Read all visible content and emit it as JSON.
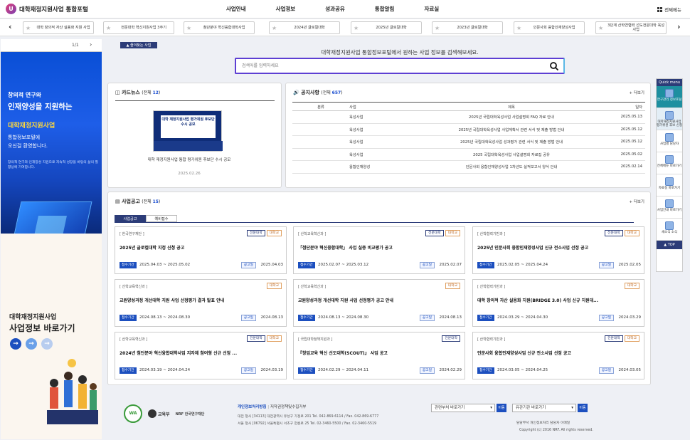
{
  "header": {
    "logo_text": "대학재정지원사업 통합포털",
    "logo_mark": "U",
    "nav": [
      "사업안내",
      "사업정보",
      "성과공유",
      "통합알림",
      "자료실"
    ],
    "all_menu": "전체메뉴"
  },
  "quickbar": {
    "items": [
      "대학 창의적 자산 실용화 지원 사업",
      "전문대학 혁신지원사업 3주기",
      "첨단분야 혁신융합대학사업",
      "2024년 글로컬대학",
      "2025년 글로컬대학",
      "2023년 글로컬대학",
      "인문사회 융합인재양성사업",
      "3단계 산학연협력 선도전문대학 육성사업"
    ]
  },
  "left_banner": {
    "page": "1/1",
    "line1": "창의적 연구와",
    "line2": "인재양성을 지원하는",
    "line3": "대학재정지원사업",
    "line4": "통합정보포털에",
    "line5": "오신걸 환영합니다.",
    "desc": "창의적 연구와 인재양성 지원으로 지속적 성장을 바탕의 삶의 질 향상에 기여합니다.",
    "bottom_line1": "대학재정지원사업",
    "bottom_line2": "사업정보 바로가기"
  },
  "toggle_label": "즐겨찾는 사업",
  "search": {
    "title": "대학재정지원사업 통합정보포털에서 원하는 사업 정보를 검색해보세요.",
    "placeholder": "검색어를 입력하세요"
  },
  "cardnews": {
    "title": "카드뉴스",
    "count_pre": "(전체 ",
    "count": "12",
    "count_post": ")",
    "image_text": "대학 재정지원사업 평가위원 후보단 수시 공모",
    "caption": "대학 재정지원사업 통합 평가위원 후보단 수시 공모",
    "date": "2025.02.26"
  },
  "notices": {
    "title": "공지사항",
    "count_pre": "(전체 ",
    "count": "657",
    "count_post": ")",
    "more": "+ 더보기",
    "headers": [
      "분류",
      "사업",
      "제목",
      "일자"
    ],
    "rows": [
      {
        "cat": "",
        "biz": "육성사업",
        "title": "2025년 국립대학육성사업 사업설명회 FAQ 자료 안내",
        "date": "2025.05.13"
      },
      {
        "cat": "",
        "biz": "육성사업",
        "title": "2025년 국립대학육성사업 사업계획서 관련 서식 및 제출 방법 안내",
        "date": "2025.05.12"
      },
      {
        "cat": "",
        "biz": "육성사업",
        "title": "2025년 국립대학육성사업 성과평가 관련 서식 및 제출 방법 안내",
        "date": "2025.05.12"
      },
      {
        "cat": "",
        "biz": "육성사업",
        "title": "2025 국립대학육성사업 사업설명회 자료집 공유",
        "date": "2025.05.02"
      },
      {
        "cat": "",
        "biz": "융합인재양성",
        "title": "인문사회 융합인재양성사업 1차년도 실적보고서 양식 안내",
        "date": "2025.02.14"
      }
    ]
  },
  "biz_announce": {
    "title": "사업공고",
    "count_pre": "(전체 ",
    "count": "15",
    "count_post": ")",
    "more": "+ 더보기",
    "tabs": [
      "사업공고",
      "예비접수"
    ],
    "period_label": "접수기간",
    "notice_label": "공고일",
    "cards": [
      {
        "org": "[ 한국연구재단 ]",
        "tags": [
          "전문대학",
          "대학교"
        ],
        "title": "2025년 글로컬대학 지정 신청 공고",
        "period": "2025.04.03 ~ 2025.05.02",
        "date": "2025.04.03"
      },
      {
        "org": "[ 산학교육혁신과 ]",
        "tags": [
          "전문대학",
          "대학교"
        ],
        "title": "「첨단분야 혁신융합대학」 사업 실증 비교평가 공고",
        "period": "2025.02.07 ~ 2025.03.12",
        "date": "2025.02.07"
      },
      {
        "org": "[ 산학협력기반과 ]",
        "tags": [
          "전문대학",
          "대학교"
        ],
        "title": "2025년 인문사회 융합인재양성사업 신규 전소사업 선정 공고",
        "period": "2025.02.05 ~ 2025.04.24",
        "date": "2025.02.05"
      },
      {
        "org": "[ 산학교육혁신과 ]",
        "tags": [
          "대학교"
        ],
        "title": "교원양성과정 개선대학 지원 사업 선정평가 결과 발표 안내",
        "period": "2024.08.13 ~ 2024.08.30",
        "date": "2024.08.13"
      },
      {
        "org": "[ 산학교육혁신과 ]",
        "tags": [
          "대학교"
        ],
        "title": "교원양성과정 개선대학 지원 사업 선정평가 공고 안내",
        "period": "2024.08.13 ~ 2024.08.30",
        "date": "2024.08.13"
      },
      {
        "org": "[ 산학협력기반과 ]",
        "tags": [
          "대학교"
        ],
        "title": "대학 창의적 자산 실용화 지원(BRIDGE 3.0) 사업 신규 지원대...",
        "period": "2024.03.29 ~ 2024.04.30",
        "date": "2024.03.29"
      },
      {
        "org": "[ 산학교육혁신과 ]",
        "tags": [
          "전문대학",
          "대학교"
        ],
        "title": "2024년 첨단분야 혁신융합대학사업 지자체 참여형 신규 선정 ...",
        "period": "2024.03.19 ~ 2024.04.24",
        "date": "2024.03.19"
      },
      {
        "org": "[ 국립대학정책지원과 ]",
        "tags": [
          "전문대학"
        ],
        "title": "『창업교육 혁신 선도대학(SCOUT)』 사업 공고",
        "period": "2024.02.29 ~ 2024.04.11",
        "date": "2024.02.29"
      },
      {
        "org": "[ 산학협력기반과 ]",
        "tags": [
          "전문대학",
          "대학교"
        ],
        "title": "인문사회 융합인재양성사업 신규 전소사업 선정 공고",
        "period": "2024.03.05 ~ 2024.04.25",
        "date": "2024.03.05"
      }
    ]
  },
  "quick_menu": {
    "title": "Quick menu",
    "items": [
      "연구관리 정보포털",
      "대학재정지원사업 평가위원 후보 신청",
      "사업별 담당자",
      "전체메뉴 바로가기",
      "자료실 바로가기",
      "사업안내 바로가기",
      "새소식 소식"
    ],
    "top": "TOP"
  },
  "footer": {
    "logo_wa": "WA",
    "logo_moe": "교육부",
    "logo_nrf": "NRF 한국연구재단",
    "link1": "개인정보처리방침",
    "link2": "저작권정책및수집거부",
    "addr1": "대전 청사  [34113] 대전광역시 유성구 가정로 201 Tel. 042-869-6114 / Fax. 042-869-6777",
    "addr2": "서울 청사  [06792] 서울특별시 서초구 헌릉로 25 Tel. 02-3460-5500 / Fax. 02-3460-5519",
    "select1": "관련부처 바로가기",
    "select2": "유관기관 바로가기",
    "go": "이동",
    "small_links": "담당부서   개인정보처리   담당자   이메일",
    "copyright": "Copyright (c) 2016 NRF. All rights reserved."
  }
}
